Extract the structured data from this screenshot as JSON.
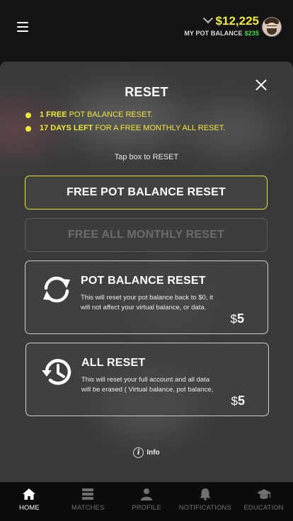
{
  "header": {
    "menu_icon": "hamburger-menu-icon",
    "balance_amount": "$12,225",
    "balance_label": "MY POT BALANCE",
    "balance_sub_amount": "$235",
    "colors": {
      "accent": "#f0e93a",
      "positive": "#3fdc3f"
    }
  },
  "modal": {
    "title": "RESET",
    "close_icon": "close-icon",
    "bullets": [
      {
        "strong": "1 FREE",
        "text": " POT BALANCE RESET."
      },
      {
        "strong": "17 DAYS LEFT",
        "text": " FOR A FREE MONTHLY ALL RESET."
      }
    ],
    "tap_hint": "Tap box to RESET",
    "free_pot_button": "FREE POT BALANCE RESET",
    "free_all_button": "FREE ALL MONTHLY RESET",
    "cards": [
      {
        "icon": "refresh-icon",
        "title": "POT BALANCE RESET",
        "description": "This will reset your pot balance back to $0, it will not affect your virtual balance, or data.",
        "currency": "$",
        "price": "5"
      },
      {
        "icon": "history-icon",
        "title": "ALL RESET",
        "description": "This will reset your full account and all data will be erased ( Virtual balance, pot balance,",
        "currency": "$",
        "price": "5"
      }
    ],
    "info_icon": "info-icon",
    "info_label": "Info"
  },
  "nav": [
    {
      "label": "HOME",
      "icon": "home-icon",
      "active": true
    },
    {
      "label": "MATCHES",
      "icon": "matches-icon",
      "active": false
    },
    {
      "label": "PROFILE",
      "icon": "profile-icon",
      "active": false
    },
    {
      "label": "NOTIFICATIONS",
      "icon": "bell-icon",
      "active": false
    },
    {
      "label": "EDUCATION",
      "icon": "graduation-cap-icon",
      "active": false
    }
  ]
}
